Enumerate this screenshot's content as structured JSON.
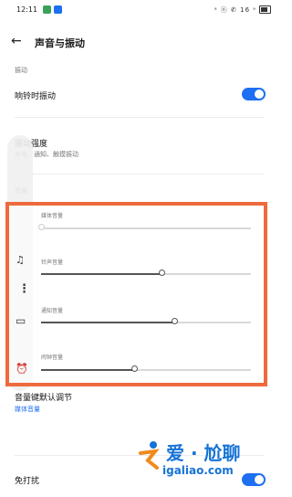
{
  "status_bar": {
    "time": "12:11",
    "right_icons": "ᵃ ⓝ ✆ 16 ᵃ"
  },
  "app_bar": {
    "back_icon": "arrow-left",
    "title": "声音与振动"
  },
  "sections": {
    "vibration_header": "振动",
    "ring_vibrate": {
      "label": "响铃时振动",
      "enabled": true
    },
    "vibration_strength": {
      "label": "振动强度",
      "sub": "来电、通知、触摸振动"
    },
    "volume_header": "音量"
  },
  "volume_panel": {
    "media": {
      "label": "媒体音量",
      "level": 0.0
    },
    "ringtone": {
      "label": "铃声音量",
      "level": 0.58
    },
    "notification": {
      "label": "通知音量",
      "level": 0.6
    },
    "alarm": {
      "label": "闹钟音量",
      "level": 0.43
    }
  },
  "volume_key": {
    "label": "音量键默认调节",
    "value": "媒体音量"
  },
  "dnd": {
    "label": "免打扰",
    "enabled": true
  },
  "watermark": {
    "brand": "爱 · 尬聊",
    "url": "igaliao.com"
  },
  "colors": {
    "accent": "#1e6ff1",
    "highlight_border": "#ee6a3c"
  }
}
